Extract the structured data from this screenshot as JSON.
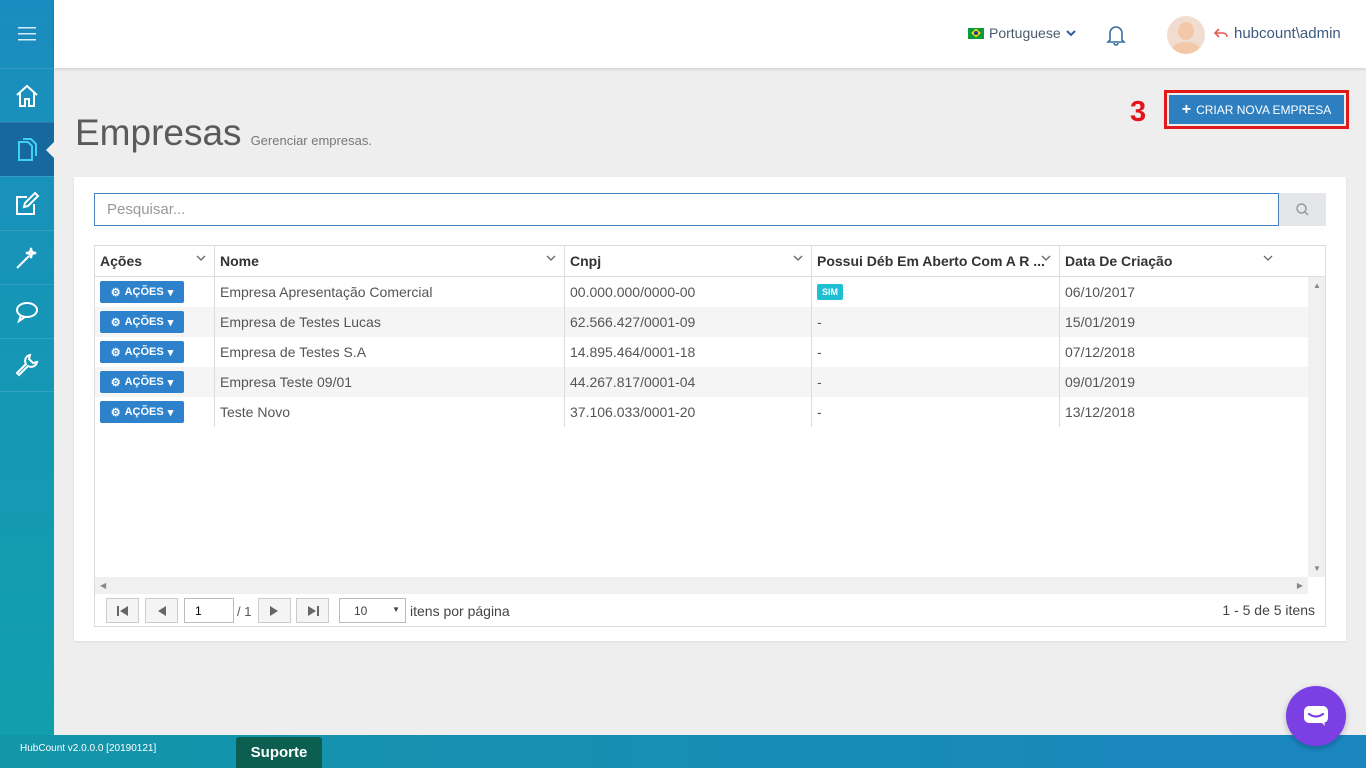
{
  "header": {
    "language": "Portuguese",
    "username": "hubcount\\admin"
  },
  "page": {
    "title": "Empresas",
    "subtitle": "Gerenciar empresas.",
    "step_number": "3",
    "create_button": "CRIAR NOVA EMPRESA"
  },
  "search": {
    "placeholder": "Pesquisar..."
  },
  "table": {
    "columns": [
      "Ações",
      "Nome",
      "Cnpj",
      "Possui Déb Em Aberto Com A R ...",
      "Data De Criação"
    ],
    "action_label": "AÇÕES",
    "rows": [
      {
        "nome": "Empresa Apresentação Comercial",
        "cnpj": "00.000.000/0000-00",
        "debito": "SIM",
        "data": "06/10/2017"
      },
      {
        "nome": "Empresa de Testes Lucas",
        "cnpj": "62.566.427/0001-09",
        "debito": "-",
        "data": "15/01/2019"
      },
      {
        "nome": "Empresa de Testes S.A",
        "cnpj": "14.895.464/0001-18",
        "debito": "-",
        "data": "07/12/2018"
      },
      {
        "nome": "Empresa Teste 09/01",
        "cnpj": "44.267.817/0001-04",
        "debito": "-",
        "data": "09/01/2019"
      },
      {
        "nome": "Teste Novo",
        "cnpj": "37.106.033/0001-20",
        "debito": "-",
        "data": "13/12/2018"
      }
    ]
  },
  "pager": {
    "page": "1",
    "of": "/ 1",
    "page_size": "10",
    "per_page_label": "itens por página",
    "info": "1 - 5 de 5 itens"
  },
  "footer": {
    "version": "HubCount v2.0.0.0 [20190121]",
    "support": "Suporte"
  },
  "colors": {
    "accent": "#2e7fc0",
    "highlight": "#e01a1a",
    "badge": "#1fbfd3",
    "chat": "#7b3fe4"
  }
}
